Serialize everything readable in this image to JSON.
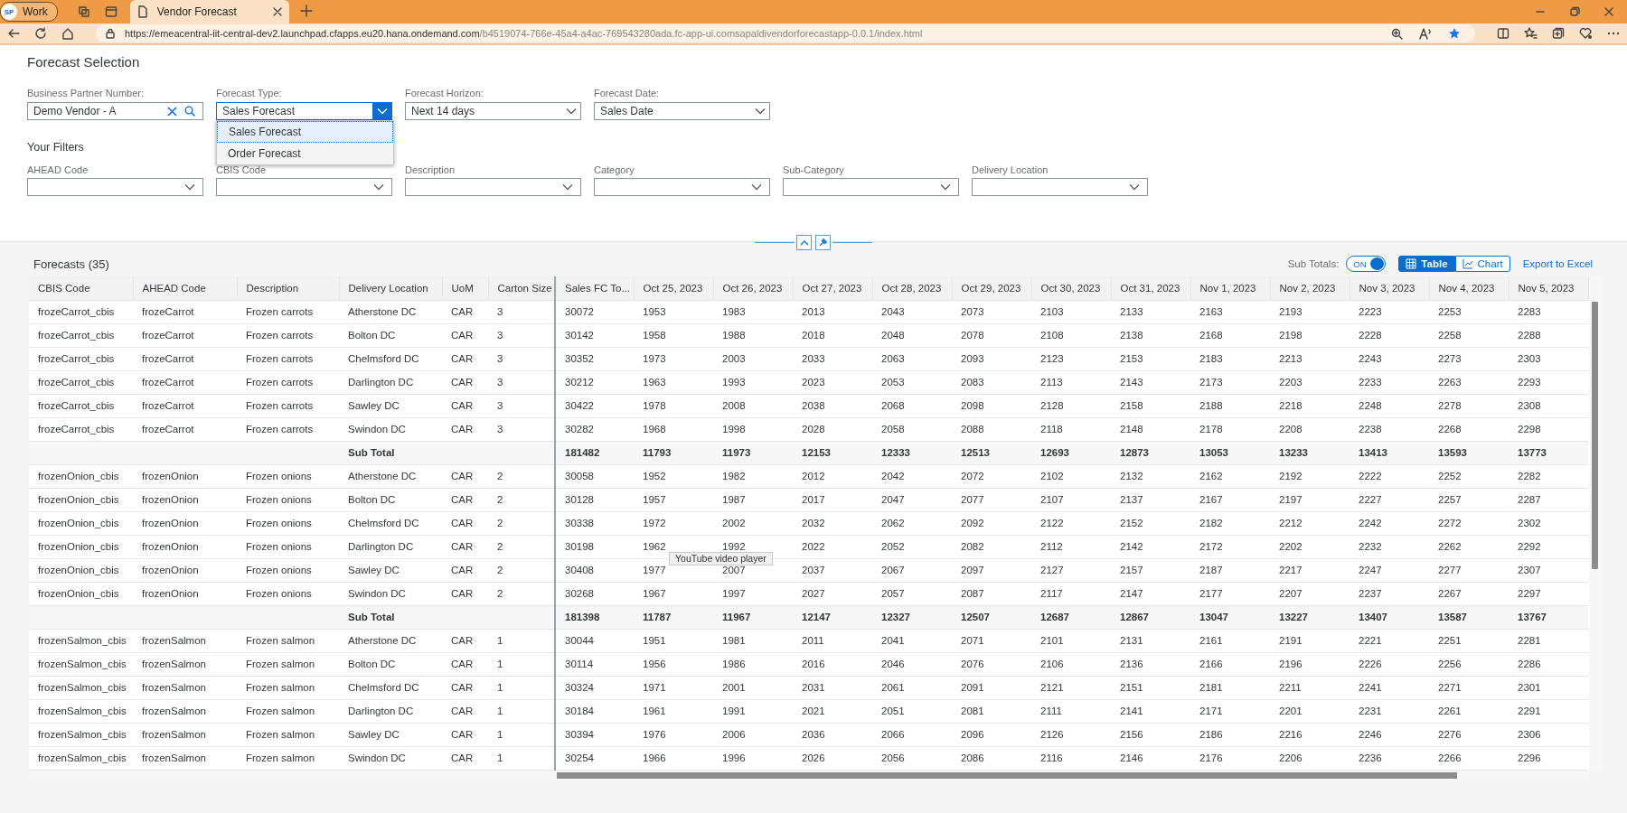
{
  "browser": {
    "profile": {
      "initials": "SP",
      "name": "Work"
    },
    "tabs": [
      {
        "title": "Vendor Forecast",
        "selected": true
      }
    ],
    "url_host": "https://emeacentral-iit-central-dev2.launchpad.cfapps.eu20.hana.ondemand.com",
    "url_path": "/b4519074-766e-45a4-a4ac-769543280ada.fc-app-ui.comsapaldivendorforecastapp-0.0.1/index.html"
  },
  "forecast_selection": {
    "title": "Forecast Selection",
    "fields": [
      {
        "label": "Business Partner Number:",
        "value": "Demo Vendor - A",
        "kind": "search"
      },
      {
        "label": "Forecast Type:",
        "value": "Sales Forecast",
        "kind": "select",
        "open": true,
        "options": [
          {
            "label": "Sales Forecast",
            "selected": true
          },
          {
            "label": "Order Forecast",
            "selected": false
          }
        ]
      },
      {
        "label": "Forecast Horizon:",
        "value": "Next 14 days",
        "kind": "select",
        "open": false
      },
      {
        "label": "Forecast Date:",
        "value": "Sales Date",
        "kind": "select",
        "open": false
      }
    ]
  },
  "your_filters": {
    "title": "Your Filters",
    "fields": [
      {
        "label": "AHEAD Code"
      },
      {
        "label": "CBIS Code"
      },
      {
        "label": "Description"
      },
      {
        "label": "Category"
      },
      {
        "label": "Sub-Category"
      },
      {
        "label": "Delivery Location"
      }
    ]
  },
  "forecasts": {
    "title": "Forecasts (35)",
    "sub_totals": {
      "label": "Sub Totals:",
      "text": "ON",
      "on": true
    },
    "views": [
      {
        "label": "Table",
        "selected": true
      },
      {
        "label": "Chart",
        "selected": false
      }
    ],
    "export": "Export to Excel",
    "columns": [
      "CBIS Code",
      "AHEAD Code",
      "Description",
      "Delivery Location",
      "UoM",
      "Carton Size",
      "Sales FC To...",
      "Oct 25, 2023",
      "Oct 26, 2023",
      "Oct 27, 2023",
      "Oct 28, 2023",
      "Oct 29, 2023",
      "Oct 30, 2023",
      "Oct 31, 2023",
      "Nov 1, 2023",
      "Nov 2, 2023",
      "Nov 3, 2023",
      "Nov 4, 2023",
      "Nov 5, 2023"
    ],
    "rows": [
      {
        "kind": "item",
        "cells": [
          "frozeCarrot_cbis",
          "frozeCarrot",
          "Frozen carrots",
          "Atherstone DC",
          "CAR",
          "3",
          "30072",
          "1953",
          "1983",
          "2013",
          "2043",
          "2073",
          "2103",
          "2133",
          "2163",
          "2193",
          "2223",
          "2253",
          "2283"
        ]
      },
      {
        "kind": "item",
        "cells": [
          "frozeCarrot_cbis",
          "frozeCarrot",
          "Frozen carrots",
          "Bolton DC",
          "CAR",
          "3",
          "30142",
          "1958",
          "1988",
          "2018",
          "2048",
          "2078",
          "2108",
          "2138",
          "2168",
          "2198",
          "2228",
          "2258",
          "2288"
        ]
      },
      {
        "kind": "item",
        "cells": [
          "frozeCarrot_cbis",
          "frozeCarrot",
          "Frozen carrots",
          "Chelmsford DC",
          "CAR",
          "3",
          "30352",
          "1973",
          "2003",
          "2033",
          "2063",
          "2093",
          "2123",
          "2153",
          "2183",
          "2213",
          "2243",
          "2273",
          "2303"
        ]
      },
      {
        "kind": "item",
        "cells": [
          "frozeCarrot_cbis",
          "frozeCarrot",
          "Frozen carrots",
          "Darlington DC",
          "CAR",
          "3",
          "30212",
          "1963",
          "1993",
          "2023",
          "2053",
          "2083",
          "2113",
          "2143",
          "2173",
          "2203",
          "2233",
          "2263",
          "2293"
        ]
      },
      {
        "kind": "item",
        "cells": [
          "frozeCarrot_cbis",
          "frozeCarrot",
          "Frozen carrots",
          "Sawley DC",
          "CAR",
          "3",
          "30422",
          "1978",
          "2008",
          "2038",
          "2068",
          "2098",
          "2128",
          "2158",
          "2188",
          "2218",
          "2248",
          "2278",
          "2308"
        ]
      },
      {
        "kind": "item",
        "cells": [
          "frozeCarrot_cbis",
          "frozeCarrot",
          "Frozen carrots",
          "Swindon DC",
          "CAR",
          "3",
          "30282",
          "1968",
          "1998",
          "2028",
          "2058",
          "2088",
          "2118",
          "2148",
          "2178",
          "2208",
          "2238",
          "2268",
          "2298"
        ]
      },
      {
        "kind": "subtotal",
        "label": "Sub Total",
        "values": [
          "181482",
          "11793",
          "11973",
          "12153",
          "12333",
          "12513",
          "12693",
          "12873",
          "13053",
          "13233",
          "13413",
          "13593",
          "13773"
        ]
      },
      {
        "kind": "item",
        "cells": [
          "frozenOnion_cbis",
          "frozenOnion",
          "Frozen onions",
          "Atherstone DC",
          "CAR",
          "2",
          "30058",
          "1952",
          "1982",
          "2012",
          "2042",
          "2072",
          "2102",
          "2132",
          "2162",
          "2192",
          "2222",
          "2252",
          "2282"
        ]
      },
      {
        "kind": "item",
        "cells": [
          "frozenOnion_cbis",
          "frozenOnion",
          "Frozen onions",
          "Bolton DC",
          "CAR",
          "2",
          "30128",
          "1957",
          "1987",
          "2017",
          "2047",
          "2077",
          "2107",
          "2137",
          "2167",
          "2197",
          "2227",
          "2257",
          "2287"
        ]
      },
      {
        "kind": "item",
        "cells": [
          "frozenOnion_cbis",
          "frozenOnion",
          "Frozen onions",
          "Chelmsford DC",
          "CAR",
          "2",
          "30338",
          "1972",
          "2002",
          "2032",
          "2062",
          "2092",
          "2122",
          "2152",
          "2182",
          "2212",
          "2242",
          "2272",
          "2302"
        ]
      },
      {
        "kind": "item",
        "cells": [
          "frozenOnion_cbis",
          "frozenOnion",
          "Frozen onions",
          "Darlington DC",
          "CAR",
          "2",
          "30198",
          "1962",
          "1992",
          "2022",
          "2052",
          "2082",
          "2112",
          "2142",
          "2172",
          "2202",
          "2232",
          "2262",
          "2292"
        ]
      },
      {
        "kind": "item",
        "cells": [
          "frozenOnion_cbis",
          "frozenOnion",
          "Frozen onions",
          "Sawley DC",
          "CAR",
          "2",
          "30408",
          "1977",
          "2007",
          "2037",
          "2067",
          "2097",
          "2127",
          "2157",
          "2187",
          "2217",
          "2247",
          "2277",
          "2307"
        ]
      },
      {
        "kind": "item",
        "cells": [
          "frozenOnion_cbis",
          "frozenOnion",
          "Frozen onions",
          "Swindon DC",
          "CAR",
          "2",
          "30268",
          "1967",
          "1997",
          "2027",
          "2057",
          "2087",
          "2117",
          "2147",
          "2177",
          "2207",
          "2237",
          "2267",
          "2297"
        ]
      },
      {
        "kind": "subtotal",
        "label": "Sub Total",
        "values": [
          "181398",
          "11787",
          "11967",
          "12147",
          "12327",
          "12507",
          "12687",
          "12867",
          "13047",
          "13227",
          "13407",
          "13587",
          "13767"
        ]
      },
      {
        "kind": "item",
        "cells": [
          "frozenSalmon_cbis",
          "frozenSalmon",
          "Frozen salmon",
          "Atherstone DC",
          "CAR",
          "1",
          "30044",
          "1951",
          "1981",
          "2011",
          "2041",
          "2071",
          "2101",
          "2131",
          "2161",
          "2191",
          "2221",
          "2251",
          "2281"
        ]
      },
      {
        "kind": "item",
        "cells": [
          "frozenSalmon_cbis",
          "frozenSalmon",
          "Frozen salmon",
          "Bolton DC",
          "CAR",
          "1",
          "30114",
          "1956",
          "1986",
          "2016",
          "2046",
          "2076",
          "2106",
          "2136",
          "2166",
          "2196",
          "2226",
          "2256",
          "2286"
        ]
      },
      {
        "kind": "item",
        "cells": [
          "frozenSalmon_cbis",
          "frozenSalmon",
          "Frozen salmon",
          "Chelmsford DC",
          "CAR",
          "1",
          "30324",
          "1971",
          "2001",
          "2031",
          "2061",
          "2091",
          "2121",
          "2151",
          "2181",
          "2211",
          "2241",
          "2271",
          "2301"
        ]
      },
      {
        "kind": "item",
        "cells": [
          "frozenSalmon_cbis",
          "frozenSalmon",
          "Frozen salmon",
          "Darlington DC",
          "CAR",
          "1",
          "30184",
          "1961",
          "1991",
          "2021",
          "2051",
          "2081",
          "2111",
          "2141",
          "2171",
          "2201",
          "2231",
          "2261",
          "2291"
        ]
      },
      {
        "kind": "item",
        "cells": [
          "frozenSalmon_cbis",
          "frozenSalmon",
          "Frozen salmon",
          "Sawley DC",
          "CAR",
          "1",
          "30394",
          "1976",
          "2006",
          "2036",
          "2066",
          "2096",
          "2126",
          "2156",
          "2186",
          "2216",
          "2246",
          "2276",
          "2306"
        ]
      },
      {
        "kind": "item",
        "cells": [
          "frozenSalmon_cbis",
          "frozenSalmon",
          "Frozen salmon",
          "Swindon DC",
          "CAR",
          "1",
          "30254",
          "1966",
          "1996",
          "2026",
          "2056",
          "2086",
          "2116",
          "2146",
          "2176",
          "2206",
          "2236",
          "2266",
          "2296"
        ]
      }
    ],
    "tooltip": "YouTube video player"
  }
}
